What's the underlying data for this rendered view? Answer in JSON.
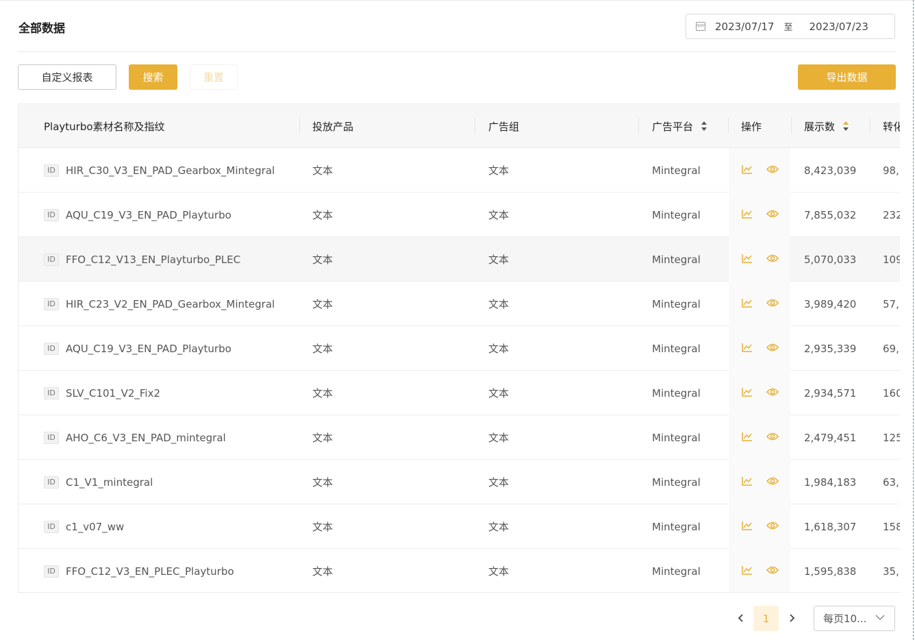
{
  "header": {
    "title": "全部数据",
    "date_start": "2023/07/17",
    "date_sep": "至",
    "date_end": "2023/07/23"
  },
  "toolbar": {
    "custom_report_label": "自定义报表",
    "search_label": "搜索",
    "reset_label": "重置",
    "export_label": "导出数据"
  },
  "table": {
    "columns": [
      "Playturbo素材名称及指纹",
      "投放产品",
      "广告组",
      "广告平台",
      "操作",
      "展示数",
      "转化"
    ],
    "id_tag": "ID",
    "rows": [
      {
        "name": "HIR_C30_V3_EN_PAD_Gearbox_Mintegral",
        "product": "文本",
        "group": "文本",
        "platform": "Mintegral",
        "impressions": "8,423,039",
        "conv": "98,"
      },
      {
        "name": "AQU_C19_V3_EN_PAD_Playturbo",
        "product": "文本",
        "group": "文本",
        "platform": "Mintegral",
        "impressions": "7,855,032",
        "conv": "232"
      },
      {
        "name": "FFO_C12_V13_EN_Playturbo_PLEC",
        "product": "文本",
        "group": "文本",
        "platform": "Mintegral",
        "impressions": "5,070,033",
        "conv": "109"
      },
      {
        "name": "HIR_C23_V2_EN_PAD_Gearbox_Mintegral",
        "product": "文本",
        "group": "文本",
        "platform": "Mintegral",
        "impressions": "3,989,420",
        "conv": "57,"
      },
      {
        "name": "AQU_C19_V3_EN_PAD_Playturbo",
        "product": "文本",
        "group": "文本",
        "platform": "Mintegral",
        "impressions": "2,935,339",
        "conv": "69,"
      },
      {
        "name": "SLV_C101_V2_Fix2",
        "product": "文本",
        "group": "文本",
        "platform": "Mintegral",
        "impressions": "2,934,571",
        "conv": "160"
      },
      {
        "name": "AHO_C6_V3_EN_PAD_mintegral",
        "product": "文本",
        "group": "文本",
        "platform": "Mintegral",
        "impressions": "2,479,451",
        "conv": "125"
      },
      {
        "name": "C1_V1_mintegral",
        "product": "文本",
        "group": "文本",
        "platform": "Mintegral",
        "impressions": "1,984,183",
        "conv": "63,"
      },
      {
        "name": "c1_v07_ww",
        "product": "文本",
        "group": "文本",
        "platform": "Mintegral",
        "impressions": "1,618,307",
        "conv": "158"
      },
      {
        "name": "FFO_C12_V3_EN_PLEC_Playturbo",
        "product": "文本",
        "group": "文本",
        "platform": "Mintegral",
        "impressions": "1,595,838",
        "conv": "35,"
      }
    ],
    "highlighted_row": 2
  },
  "pagination": {
    "current_page": "1",
    "page_size_label": "每页10..."
  },
  "colors": {
    "accent": "#e8b034",
    "accent_light": "#fdf3dd"
  },
  "icons": {
    "row_actions": [
      "line-chart-icon",
      "eye-icon"
    ]
  }
}
